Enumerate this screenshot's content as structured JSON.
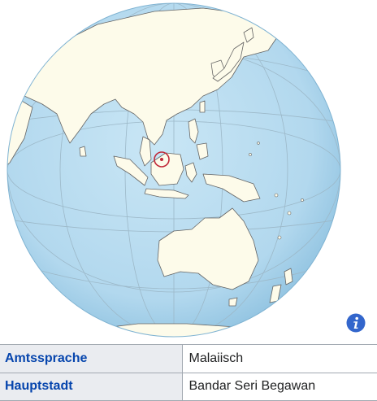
{
  "map": {
    "ocean_color": "#b8dcef",
    "land_color": "#fdfbea",
    "border_color": "#646464",
    "highlight_color": "#c12838"
  },
  "info_button": {
    "icon": "info-icon",
    "color": "#3366cc"
  },
  "facts": [
    {
      "label": "Amtssprache",
      "value": "Malaiisch"
    },
    {
      "label": "Hauptstadt",
      "value": "Bandar Seri Begawan"
    }
  ]
}
